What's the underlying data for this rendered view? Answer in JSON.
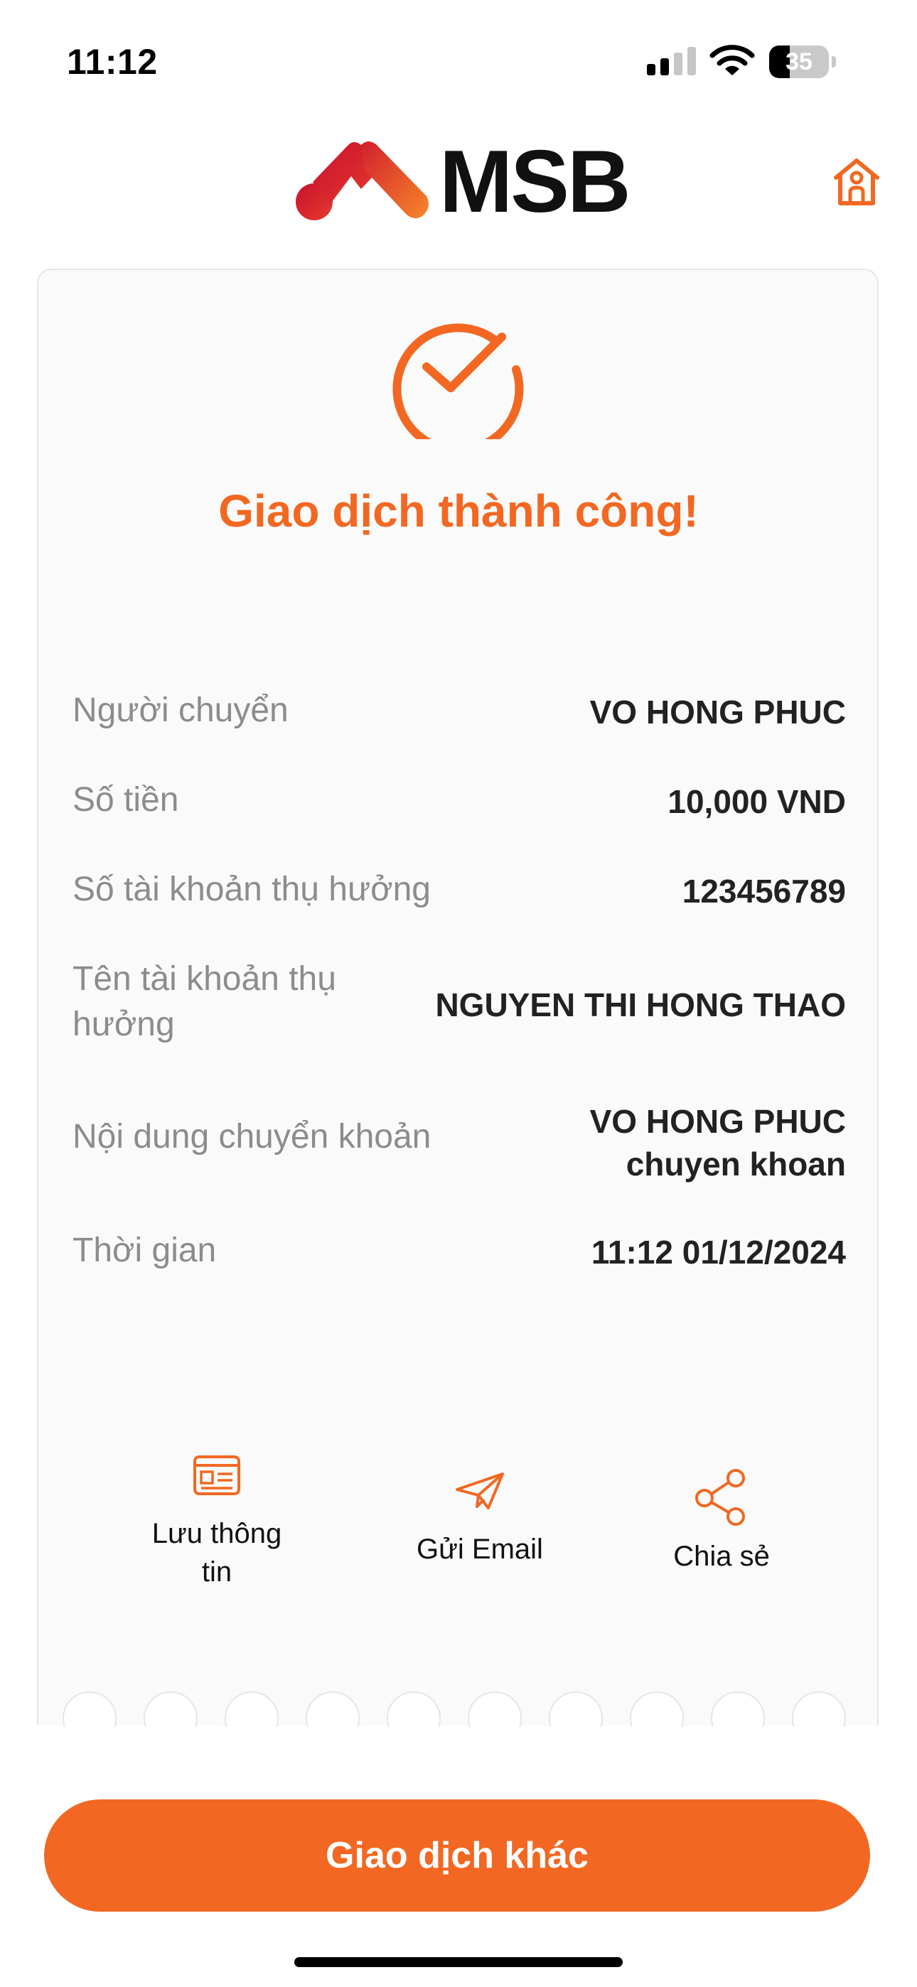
{
  "status_bar": {
    "time": "11:12",
    "battery_level": "35",
    "battery_fraction": 0.35
  },
  "header": {
    "logo_text": "MSB",
    "home_icon": "home-icon"
  },
  "result": {
    "title": "Giao dịch thành công!",
    "icon": "check-circle-icon"
  },
  "details": [
    {
      "label": "Người chuyển",
      "value": "VO HONG PHUC"
    },
    {
      "label": "Số tiền",
      "value": "10,000 VND"
    },
    {
      "label": "Số tài khoản thụ hưởng",
      "value": "123456789"
    },
    {
      "label": "Tên tài khoản thụ hưởng",
      "value": "NGUYEN THI HONG THAO"
    },
    {
      "label": "Nội dung chuyển khoản",
      "value": "VO HONG PHUC chuyen khoan"
    },
    {
      "label": "Thời gian",
      "value": "11:12 01/12/2024"
    }
  ],
  "actions": [
    {
      "label": "Lưu thông tin",
      "icon": "save-info-icon"
    },
    {
      "label": "Gửi Email",
      "icon": "send-email-icon"
    },
    {
      "label": "Chia sẻ",
      "icon": "share-icon"
    }
  ],
  "primary_button": {
    "label": "Giao dịch khác"
  },
  "colors": {
    "accent": "#f26822",
    "logo_red": "#e0282e",
    "logo_orange": "#f7792b"
  }
}
